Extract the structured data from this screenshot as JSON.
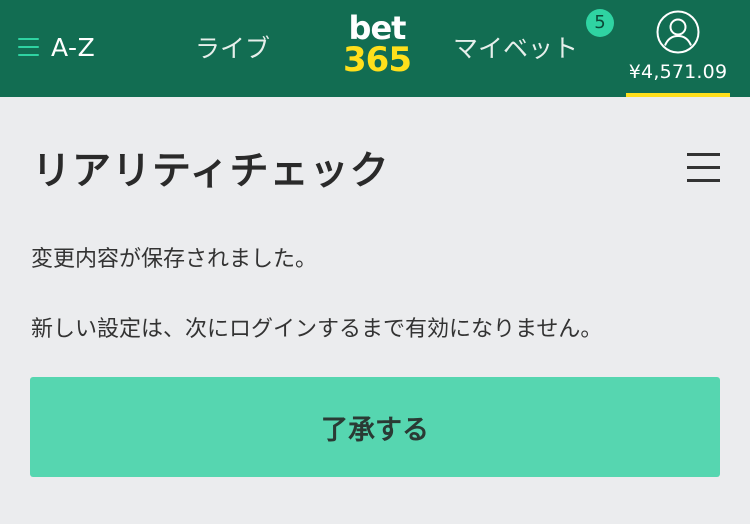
{
  "header": {
    "az_label": "A-Z",
    "live_label": "ライブ",
    "logo_top": "bet",
    "logo_bottom": "365",
    "mybets_label": "マイベット",
    "mybets_badge": "5",
    "balance": "¥4,571.09"
  },
  "main": {
    "title": "リアリティチェック",
    "message_saved": "変更内容が保存されました。",
    "message_next_login": "新しい設定は、次にログインするまで有効になりません。",
    "accept_label": "了承する"
  },
  "colors": {
    "header_bg": "#126d52",
    "accent_green": "#2fd3a2",
    "logo_yellow": "#ffdf1b",
    "button_bg": "#56d6b0",
    "page_bg": "#ebecee"
  }
}
